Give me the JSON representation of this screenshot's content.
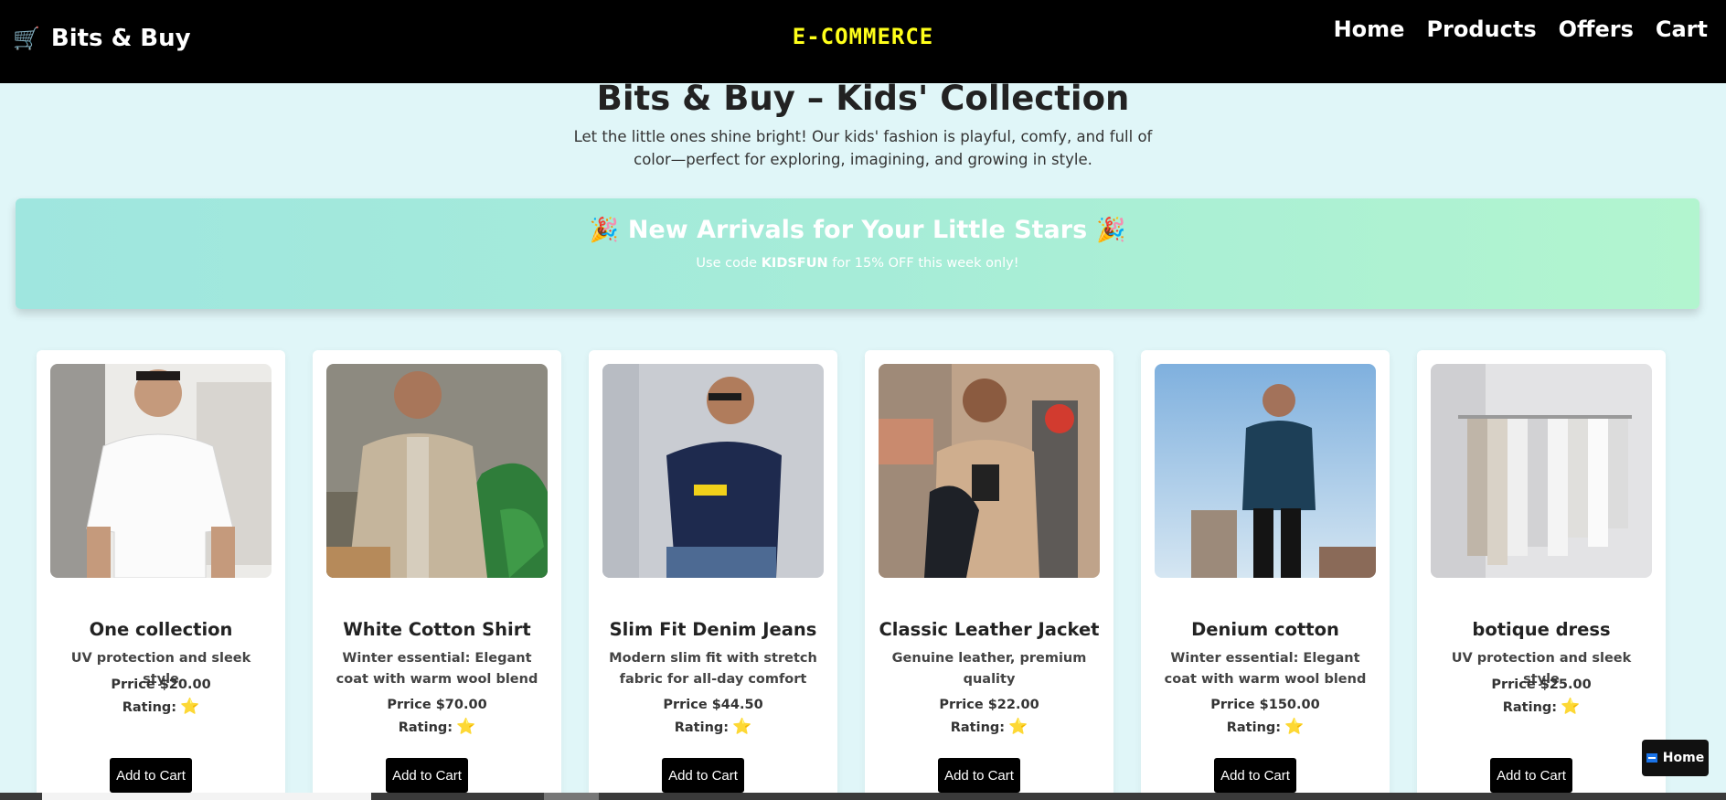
{
  "header": {
    "brand": "Bits & Buy",
    "brand_icon": "cart-icon",
    "center_title": "E-COMMERCE",
    "nav": [
      "Home",
      "Products",
      "Offers",
      "Cart"
    ]
  },
  "hero": {
    "title": "Bits & Buy – Kids' Collection",
    "subtitle": "Let the little ones shine bright! Our kids' fashion is playful, comfy, and full of color—perfect for exploring, imagining, and growing in style."
  },
  "banner": {
    "title": "New Arrivals for Your Little Stars",
    "icon": "party-popper-icon",
    "code_prefix": "Use code",
    "code": "KIDSFUN",
    "code_suffix": "for 15% OFF this week only!"
  },
  "products": [
    {
      "name": "One collection",
      "desc": "UV protection and sleek style",
      "price": "Prrice $20.00",
      "rating_label": "Rating:",
      "rating": "⭐",
      "button": "Add to Cart"
    },
    {
      "name": "White Cotton Shirt",
      "desc": "Winter essential: Elegant coat with warm wool blend",
      "price": "Prrice $70.00",
      "rating_label": "Rating:",
      "rating": "⭐",
      "button": "Add to Cart"
    },
    {
      "name": "Slim Fit Denim Jeans",
      "desc": "Modern slim fit with stretch fabric for all-day comfort",
      "price": "Prrice $44.50",
      "rating_label": "Rating:",
      "rating": "⭐",
      "button": "Add to Cart"
    },
    {
      "name": "Classic Leather Jacket",
      "desc": "Genuine leather, premium quality",
      "price": "Prrice $22.00",
      "rating_label": "Rating:",
      "rating": "⭐",
      "button": "Add to Cart"
    },
    {
      "name": "Denium cotton",
      "desc": "Winter essential: Elegant coat with warm wool blend",
      "price": "Prrice $150.00",
      "rating_label": "Rating:",
      "rating": "⭐",
      "button": "Add to Cart"
    },
    {
      "name": "botique dress",
      "desc": "UV protection and sleek style",
      "price": "Prrice $25.00",
      "rating_label": "Rating:",
      "rating": "⭐",
      "button": "Add to Cart"
    }
  ],
  "floating": {
    "home_label": "Home"
  },
  "colors": {
    "header_bg": "#000000",
    "center_title": "#ffff1a",
    "page_bg": "#e0f6f8",
    "button_bg": "#000000",
    "star": "#f4c20d"
  }
}
